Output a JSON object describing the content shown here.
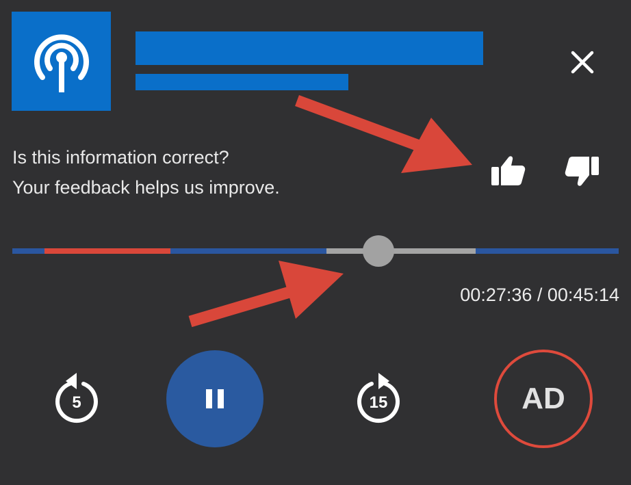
{
  "header": {
    "artwork_icon": "podcast-broadcast-icon",
    "close_icon": "close-icon"
  },
  "feedback": {
    "line1": "Is this information correct?",
    "line2": "Your feedback helps us improve.",
    "thumbs_up_icon": "thumbs-up-icon",
    "thumbs_down_icon": "thumbs-down-icon"
  },
  "player": {
    "progress_fraction": 0.604,
    "time_display": "00:27:36 / 00:45:14",
    "rewind_label": "5",
    "forward_label": "15",
    "ad_label": "AD",
    "pause_icon": "pause-icon"
  },
  "colors": {
    "background": "#303032",
    "brand_blue": "#0a6fc9",
    "track_blue": "#2a56a0",
    "ad_marker_red": "#d9473a",
    "buffered_gray": "#a4a4a4",
    "pause_button": "#2a5aa0",
    "annotation_arrow": "#d9473a"
  }
}
